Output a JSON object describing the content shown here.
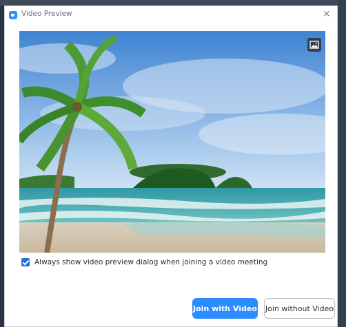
{
  "window": {
    "title": "Video Preview"
  },
  "titlebar": {
    "close_label": "×"
  },
  "preview_options": {
    "always_show_label": "Always show video preview dialog when joining a video meeting",
    "always_show_checked": true
  },
  "actions": {
    "join_with_video": "Join with Video",
    "join_without_video": "Join without Video"
  },
  "colors": {
    "accent": "#2d8cff",
    "checkbox": "#1f6fe0"
  },
  "icons": {
    "app": "video-camera-icon",
    "close": "close-icon",
    "background_toggle": "image-icon"
  }
}
